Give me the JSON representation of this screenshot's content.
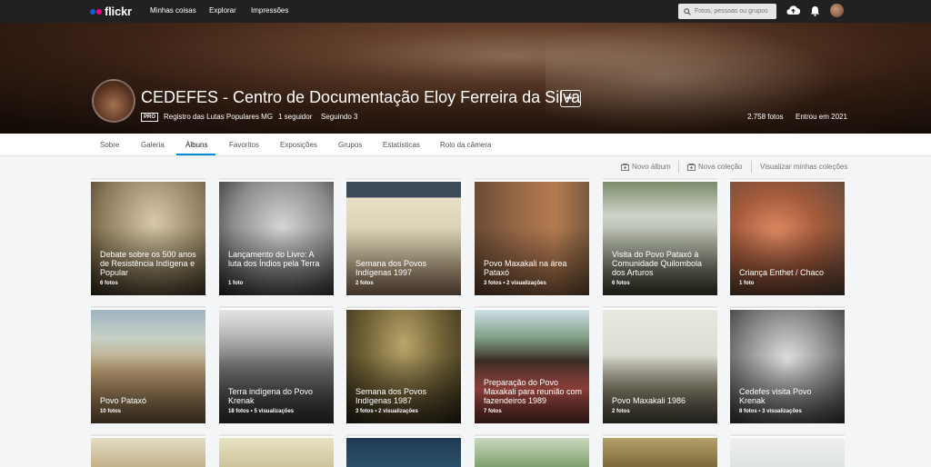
{
  "topnav": {
    "logo": "flickr",
    "links": [
      "Minhas coisas",
      "Explorar",
      "Impressões"
    ],
    "search_placeholder": "Fotos, pessoas ou grupos"
  },
  "profile": {
    "name": "CEDEFES - Centro de Documentação Eloy Ferreira da Silva",
    "more_label": "•••",
    "pro_badge": "PRO",
    "subtitle": "Registro das Lutas Populares MG",
    "followers": "1 seguidor",
    "following": "Seguindo 3",
    "photos": "2.758 fotos",
    "joined": "Entrou em 2021"
  },
  "subnav": {
    "items": [
      "Sobre",
      "Galeria",
      "Álbuns",
      "Favoritos",
      "Exposições",
      "Grupos",
      "Estatísticas",
      "Rolo da câmera"
    ],
    "active": "Álbuns"
  },
  "actions": {
    "new_album": "Novo álbum",
    "new_collection": "Nova coleção",
    "view_collections": "Visualizar minhas coleções"
  },
  "albums": [
    {
      "title": "Debate sobre os 500 anos de Resistência Indígena e Popular",
      "meta": "6 fotos"
    },
    {
      "title": "Lançamento do Livro: A luta dos Índios pela Terra",
      "meta": "1 foto"
    },
    {
      "title": "Semana dos Povos Indígenas 1997",
      "meta": "2 fotos"
    },
    {
      "title": "Povo Maxakali na área Pataxó",
      "meta": "3 fotos  •  2 visualizações"
    },
    {
      "title": "Visita do Povo Pataxó à Comunidade Quilombola dos Arturos",
      "meta": "6 fotos"
    },
    {
      "title": "Criança Enthet / Chaco",
      "meta": "1 foto"
    },
    {
      "title": "Povo Pataxó",
      "meta": "10 fotos"
    },
    {
      "title": "Terra indígena do Povo Krenak",
      "meta": "18 fotos  •  5 visualizações"
    },
    {
      "title": "Semana dos Povos Indígenas 1987",
      "meta": "3 fotos  •  2 visualizações"
    },
    {
      "title": "Preparação do Povo Maxakali para reunião com fazendeiros 1989",
      "meta": "7 fotos"
    },
    {
      "title": "Povo Maxakali 1986",
      "meta": "2 fotos"
    },
    {
      "title": "Cedefes visita Povo Krenak",
      "meta": "8 fotos  •  3 visualizações"
    }
  ],
  "colors": {
    "topbar": "#212124",
    "accent": "#008ecf",
    "logo_blue": "#0063dc",
    "logo_pink": "#ff0084"
  }
}
